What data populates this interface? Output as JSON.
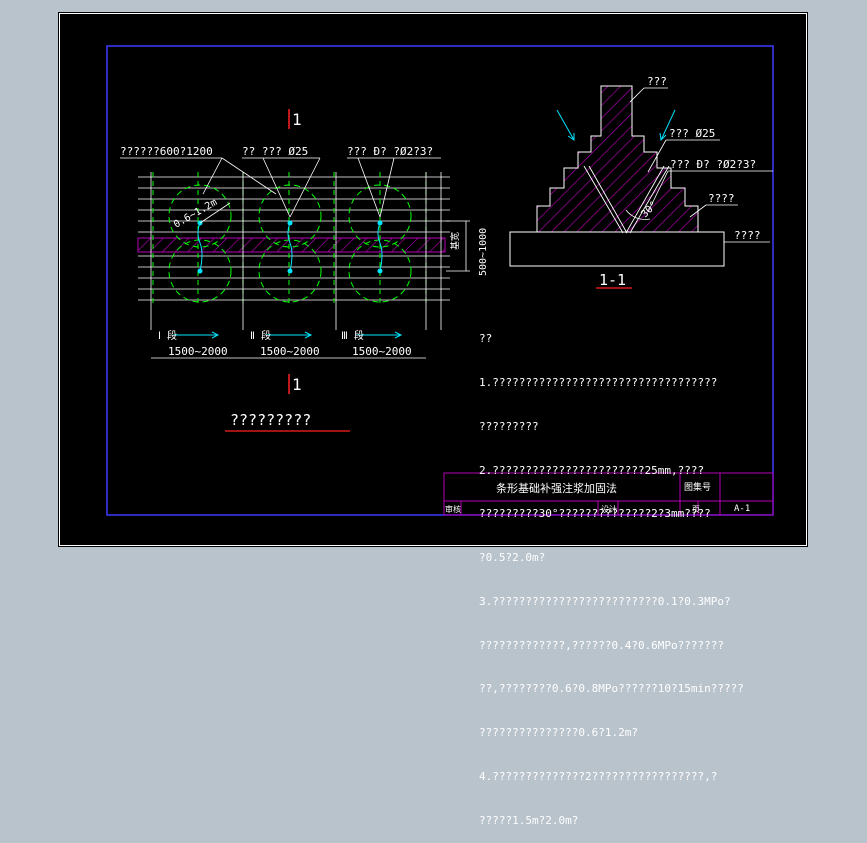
{
  "colors": {
    "frame": "#3b3bff",
    "hatch": "#b400b4",
    "green": "#00ff00",
    "cyan": "#00e5ff",
    "red": "#ff2020",
    "text": "#ffffff"
  },
  "plan": {
    "section_mark_top": "1",
    "section_mark_bottom": "1",
    "leader_spacing": "??????600?1200",
    "leader_grout_pipe": "??  ??? Ø25",
    "leader_grout_hole": "???  Ð?  ?Ø2?3?",
    "radius_label": "0.6~1.2m",
    "width_dim": "500~1000",
    "width_dim_label": "基宽",
    "segments": [
      {
        "name": "Ⅰ 段",
        "range": "1500~2000"
      },
      {
        "name": "Ⅱ 段",
        "range": "1500~2000"
      },
      {
        "name": "Ⅲ 段",
        "range": "1500~2000"
      }
    ],
    "caption": "?????????"
  },
  "section": {
    "label_top": "???",
    "label_pipe": "??? Ø25",
    "label_hole": "???  Ð?  ?Ø2?3?",
    "label_footing": "????",
    "label_slab": "????",
    "angle": "30°",
    "caption": "1-1"
  },
  "notes": {
    "heading": "??",
    "lines": [
      "1.??????????????????????????????????",
      "?????????",
      "2.???????????????????????25mm,????",
      "?????????30°??????????????2?3mm????",
      "?0.5?2.0m?",
      "3.?????????????????????????0.1?0.3MPo?",
      "?????????????,??????0.4?0.6MPo???????",
      "??,????????0.6?0.8MPo??????10?15min?????",
      "???????????????0.6?1.2m?",
      "4.??????????????2?????????????????,?",
      "?????1.5m?2.0m?"
    ]
  },
  "title_block": {
    "title": "条形基础补强注浆加固法",
    "atlas_label": "图集号",
    "review_label": "审核",
    "design_label": "设计",
    "page_label": "页",
    "sheet_no": "A-1"
  }
}
